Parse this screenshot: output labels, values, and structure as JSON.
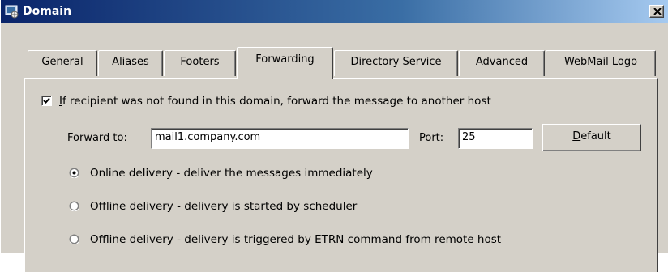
{
  "window": {
    "title": "Domain",
    "app_icon": "domain-window-icon",
    "close_icon": "close-icon"
  },
  "tabs": [
    {
      "label": "General",
      "active": false
    },
    {
      "label": "Aliases",
      "active": false
    },
    {
      "label": "Footers",
      "active": false
    },
    {
      "label": "Forwarding",
      "active": true
    },
    {
      "label": "Directory Service",
      "active": false
    },
    {
      "label": "Advanced",
      "active": false
    },
    {
      "label": "WebMail Logo",
      "active": false
    }
  ],
  "forwarding": {
    "enable_checkbox": {
      "label": "If recipient was not found in this domain, forward the message to another host",
      "checked": true
    },
    "forward_to": {
      "label": "Forward to:",
      "value": "mail1.company.com"
    },
    "port": {
      "label": "Port:",
      "value": "25"
    },
    "default_button": {
      "label": "Default"
    },
    "delivery_options": [
      {
        "label": "Online delivery - deliver the messages immediately",
        "selected": true
      },
      {
        "label": "Offline delivery - delivery is started by scheduler",
        "selected": false
      },
      {
        "label": "Offline delivery - delivery is triggered by ETRN command from remote host",
        "selected": false
      }
    ]
  }
}
